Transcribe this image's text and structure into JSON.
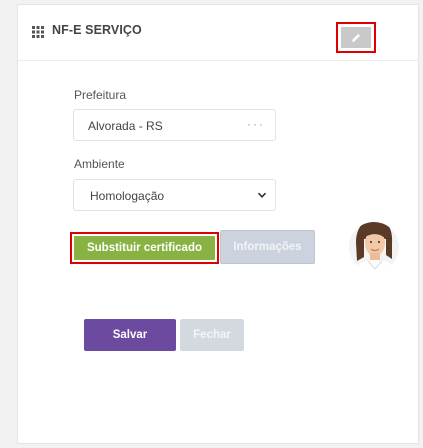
{
  "header": {
    "title": "NF-E SERVIÇO",
    "grid_icon": "grid-icon",
    "edit_icon": "pencil-icon"
  },
  "form": {
    "prefeitura": {
      "label": "Prefeitura",
      "value": "Alvorada - RS",
      "more": "···"
    },
    "ambiente": {
      "label": "Ambiente",
      "value": "Homologação"
    }
  },
  "actions": {
    "replace_certificate": "Substituir certificado",
    "information": "Informações",
    "save": "Salvar",
    "close": "Fechar"
  },
  "colors": {
    "green": "#88b342",
    "purple": "#6b4aa0",
    "disabled": "#ccd3de",
    "highlight_red": "#e00000"
  }
}
